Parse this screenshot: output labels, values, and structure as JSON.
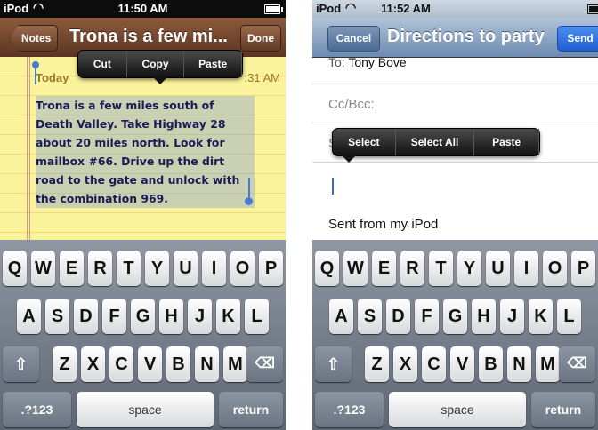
{
  "left_screen": {
    "status": {
      "carrier": "iPod",
      "time": "11:50 AM"
    },
    "navbar": {
      "back": "Notes",
      "title": "Trona is a few mi...",
      "done": "Done"
    },
    "edit_menu": [
      "Cut",
      "Copy",
      "Paste"
    ],
    "note": {
      "date": "Today",
      "time": ":31 AM",
      "body": "Trona is a few miles south of Death Valley. Take Highway 28 about 20 miles north. Look for mailbox #66. Drive up the dirt road to the gate and unlock with the combination 969."
    }
  },
  "right_screen": {
    "status": {
      "carrier": "iPod",
      "time": "11:52 AM"
    },
    "navbar": {
      "cancel": "Cancel",
      "title": "Directions to party",
      "send": "Send"
    },
    "edit_menu": [
      "Select",
      "Select All",
      "Paste"
    ],
    "fields": {
      "to_label": "To:",
      "to_value": "Tony Bove",
      "cc": "Cc/Bcc:"
    },
    "body": {
      "signature": "Sent from my iPod"
    }
  },
  "keyboard": {
    "row1": [
      "Q",
      "W",
      "E",
      "R",
      "T",
      "Y",
      "U",
      "I",
      "O",
      "P"
    ],
    "row2": [
      "A",
      "S",
      "D",
      "F",
      "G",
      "H",
      "J",
      "K",
      "L"
    ],
    "row3": [
      "Z",
      "X",
      "C",
      "V",
      "B",
      "N",
      "M"
    ],
    "numbers": ".?123",
    "space": "space",
    "return": "return",
    "shift_icon": "shift-icon",
    "delete_icon": "delete-icon"
  },
  "colors": {
    "notes_bar": "#6e4430",
    "mail_bar": "#6d8ab0",
    "paper": "#fbf29c",
    "send_button": "#2f6fdc"
  }
}
